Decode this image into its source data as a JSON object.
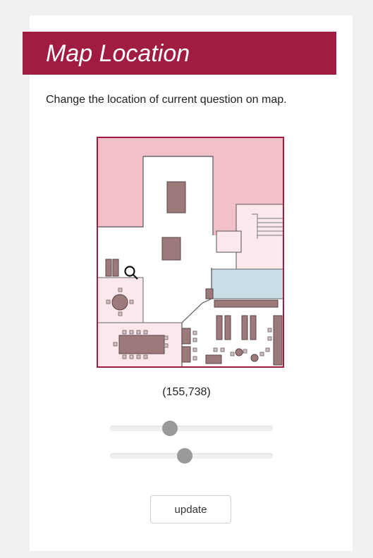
{
  "header": {
    "title": "Map Location"
  },
  "description": "Change the location of current question on map.",
  "coordinates": "(155,738)",
  "sliders": [
    {
      "name": "x-slider",
      "value_fraction": 0.37
    },
    {
      "name": "y-slider",
      "value_fraction": 0.46
    }
  ],
  "update_label": "update",
  "icons": {
    "marker": "magnifier-icon"
  },
  "colors": {
    "accent": "#a01c40",
    "map_border": "#a01c40",
    "room_pink": "#f2c0c8",
    "room_blue": "#c8dfe8",
    "furniture": "#9c7a7c"
  }
}
